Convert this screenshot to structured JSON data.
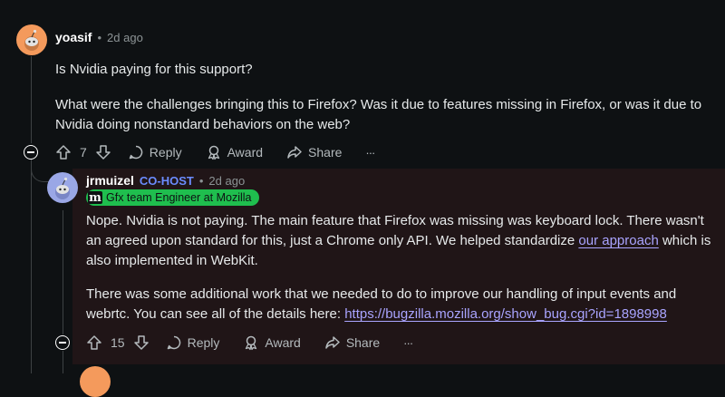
{
  "comment1": {
    "username": "yoasif",
    "separator": "•",
    "time": "2d ago",
    "paragraph1": "Is Nvidia paying for this support?",
    "paragraph2": "What were the challenges bringing this to Firefox? Was it due to features missing in Firefox, or was it due to Nvidia doing nonstandard behaviors on the web?",
    "votes": "7",
    "reply_label": "Reply",
    "award_label": "Award",
    "share_label": "Share",
    "more_label": "···"
  },
  "comment2": {
    "username": "jrmuizel",
    "role_badge": "CO-HOST",
    "separator": "•",
    "time": "2d ago",
    "flair_icon": "m",
    "flair_text": "Gfx team Engineer at Mozilla",
    "p1_before": "Nope. Nvidia is not paying. The main feature that Firefox was missing was keyboard lock. There wasn't an agreed upon standard for this, just a Chrome only API. We helped standardize ",
    "p1_link": "our approach",
    "p1_after": " which is also implemented in WebKit.",
    "p2_before": "There was some additional work that we needed to do to improve our handling of input events and webrtc. You can see all of the details here: ",
    "p2_link": "https://bugzilla.mozilla.org/show_bug.cgi?id=1898998",
    "votes": "15",
    "reply_label": "Reply",
    "award_label": "Award",
    "share_label": "Share",
    "more_label": "···"
  },
  "colors": {
    "background": "#0e1113",
    "reply_background": "#201517",
    "link": "#a9a4ff",
    "cohost": "#6b8cff",
    "flair": "#1fbe4e"
  },
  "icons": [
    "snoo-avatar-icon",
    "upvote-icon",
    "downvote-icon",
    "comment-icon",
    "award-icon",
    "share-icon",
    "collapse-icon",
    "more-icon"
  ]
}
